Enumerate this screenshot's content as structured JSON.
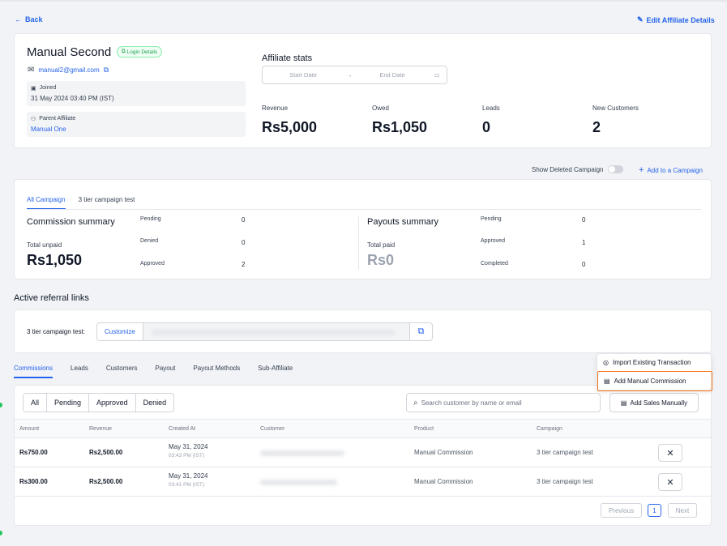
{
  "nav": {
    "back_label": "Back",
    "edit_label": "Edit Affiliate Details"
  },
  "profile": {
    "name": "Manual Second",
    "login_badge": "Login Details",
    "email": "manual2@gmail.com",
    "joined_label": "Joined",
    "joined_value": "31 May 2024 03:40 PM (IST)",
    "parent_label": "Parent Affiliate",
    "parent_value": "Manual One"
  },
  "stats": {
    "title": "Affiliate stats",
    "start_placeholder": "Start Date",
    "end_placeholder": "End Date",
    "items": [
      {
        "label": "Revenue",
        "value": "Rs5,000"
      },
      {
        "label": "Owed",
        "value": "Rs1,050"
      },
      {
        "label": "Leads",
        "value": "0"
      },
      {
        "label": "New Customers",
        "value": "2"
      }
    ]
  },
  "campaign_controls": {
    "show_deleted_label": "Show Deleted Campaign",
    "add_campaign_label": "Add to a Campaign"
  },
  "campaign_tabs": [
    "All Campaign",
    "3 tier campaign test"
  ],
  "commission": {
    "title": "Commission summary",
    "total_label": "Total unpaid",
    "total_value": "Rs1,050",
    "rows": [
      {
        "label": "Pending",
        "value": "0"
      },
      {
        "label": "Denied",
        "value": "0"
      },
      {
        "label": "Approved",
        "value": "2"
      }
    ]
  },
  "payouts": {
    "title": "Payouts summary",
    "total_label": "Total paid",
    "total_value": "Rs0",
    "rows": [
      {
        "label": "Pending",
        "value": "0"
      },
      {
        "label": "Approved",
        "value": "1"
      },
      {
        "label": "Completed",
        "value": "0"
      }
    ]
  },
  "referral": {
    "section_title": "Active referral links",
    "campaign_label": "3 tier campaign test:",
    "customize_label": "Customize"
  },
  "bottom_tabs": [
    "Commissions",
    "Leads",
    "Customers",
    "Payout",
    "Payout Methods",
    "Sub-Affiliate"
  ],
  "dropdown": {
    "import_label": "Import Existing Transaction",
    "add_manual_label": "Add Manual Commission"
  },
  "filters": [
    "All",
    "Pending",
    "Approved",
    "Denied"
  ],
  "search": {
    "placeholder": "Search customer by name or email"
  },
  "add_sales_label": "Add Sales Manually",
  "table": {
    "headers": [
      "Amount",
      "Revenue",
      "Created At",
      "Customer",
      "Product",
      "Campaign"
    ],
    "rows": [
      {
        "amount": "Rs750.00",
        "revenue": "Rs2,500.00",
        "date": "May 31, 2024",
        "time": "03:43 PM (IST)",
        "product": "Manual Commission",
        "campaign": "3 tier campaign test"
      },
      {
        "amount": "Rs300.00",
        "revenue": "Rs2,500.00",
        "date": "May 31, 2024",
        "time": "03:41 PM (IST)",
        "product": "Manual Commission",
        "campaign": "3 tier campaign test"
      }
    ]
  },
  "pagination": {
    "previous": "Previous",
    "page": "1",
    "next": "Next"
  },
  "colors": {
    "accent": "#2563eb",
    "highlight": "#f97316",
    "badge_green": "#16a34a"
  }
}
